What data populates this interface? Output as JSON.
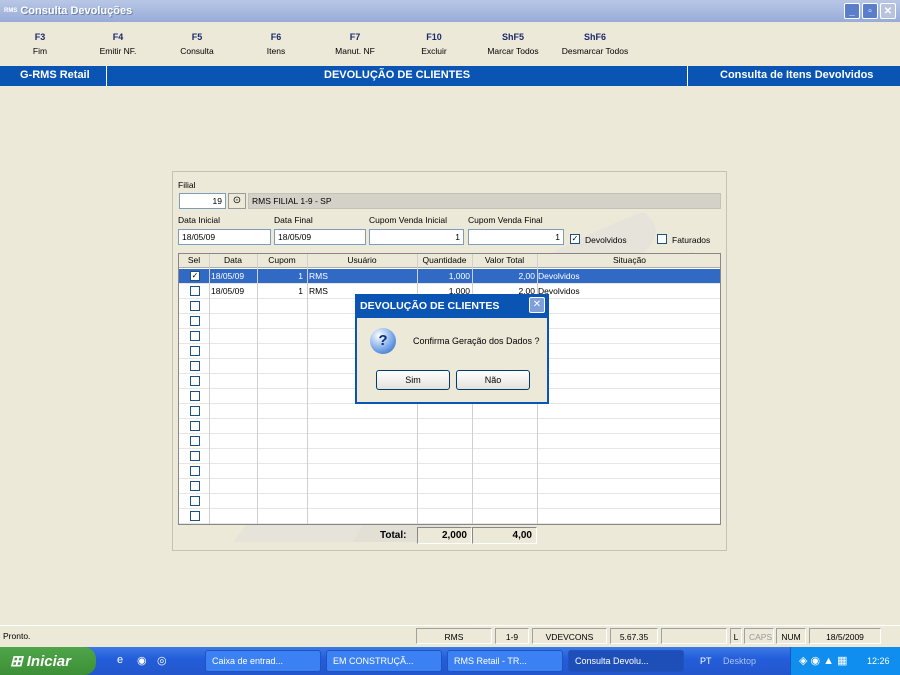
{
  "window": {
    "logo": "RMS",
    "title": "Consulta Devoluções"
  },
  "toolbar": [
    {
      "key": "F3",
      "label": "Fim"
    },
    {
      "key": "F4",
      "label": "Emitir NF."
    },
    {
      "key": "F5",
      "label": "Consulta"
    },
    {
      "key": "F6",
      "label": "Itens"
    },
    {
      "key": "F7",
      "label": "Manut. NF"
    },
    {
      "key": "F10",
      "label": "Excluir"
    },
    {
      "key": "ShF5",
      "label": "Marcar Todos"
    },
    {
      "key": "ShF6",
      "label": "Desmarcar Todos"
    }
  ],
  "banner": {
    "left": "G-RMS Retail",
    "center": "DEVOLUÇÃO DE CLIENTES",
    "right": "Consulta de Itens Devolvidos"
  },
  "form": {
    "filial_label": "Filial",
    "filial_value": "19",
    "filial_desc": "RMS FILIAL 1-9 - SP",
    "data_inicial_label": "Data Inicial",
    "data_inicial": "18/05/09",
    "data_final_label": "Data Final",
    "data_final": "18/05/09",
    "cupom_ini_label": "Cupom Venda Inicial",
    "cupom_ini": "1",
    "cupom_fim_label": "Cupom Venda Final",
    "cupom_fim": "1",
    "devolvidos_label": "Devolvidos",
    "devolvidos_checked": true,
    "faturados_label": "Faturados",
    "faturados_checked": false
  },
  "grid": {
    "columns": [
      "Sel",
      "Data",
      "Cupom",
      "Usuário",
      "Quantidade",
      "Valor Total",
      "Situação"
    ],
    "rows": [
      {
        "sel": true,
        "data": "18/05/09",
        "cupom": "1",
        "usuario": "RMS",
        "quantidade": "1,000",
        "valor": "2,00",
        "situacao": "Devolvidos"
      },
      {
        "sel": false,
        "data": "18/05/09",
        "cupom": "1",
        "usuario": "RMS",
        "quantidade": "1,000",
        "valor": "2,00",
        "situacao": "Devolvidos"
      }
    ],
    "empty_rows": 15
  },
  "totals": {
    "label": "Total:",
    "quantidade": "2,000",
    "valor": "4,00"
  },
  "dialog": {
    "title": "DEVOLUÇÃO DE CLIENTES",
    "message": "Confirma Geração dos Dados ?",
    "yes": "Sim",
    "no": "Não"
  },
  "status": {
    "message": "Pronto.",
    "user": "RMS",
    "filial": "1-9",
    "program": "VDEVCONS",
    "version": "5.67.35",
    "l": "L",
    "caps": "CAPS",
    "num": "NUM",
    "date": "18/5/2009"
  },
  "taskbar": {
    "start": "Iniciar",
    "items": [
      "Caixa de entrad...",
      "EM CONSTRUÇÃ...",
      "RMS Retail - TR...",
      "Consulta Devolu..."
    ],
    "lang": "PT",
    "desktop": "Desktop",
    "clock": "12:26"
  }
}
